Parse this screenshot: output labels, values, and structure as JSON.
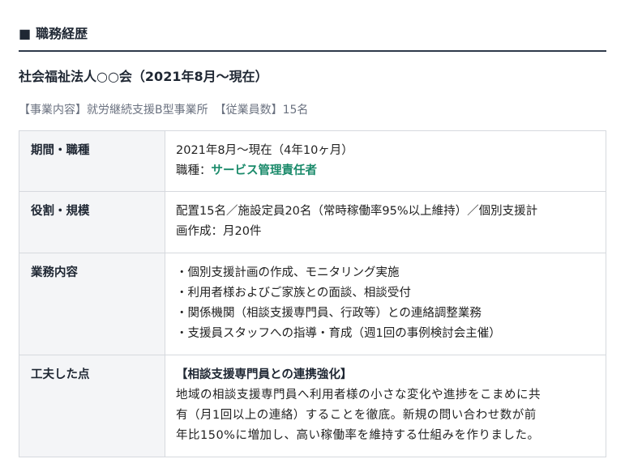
{
  "section": {
    "marker": "■",
    "title": "職務経歴"
  },
  "company": {
    "name": "社会福祉法人○○会（2021年8月〜現在）",
    "business": "【事業内容】就労継続支援B型事業所",
    "employees": "【従業員数】15名"
  },
  "rows": [
    {
      "label": "期間・職種",
      "lines": [
        "2021年8月〜現在（4年10ヶ月）"
      ],
      "job_prefix": "職種：",
      "job_title": "サービス管理責任者"
    },
    {
      "label": "役割・規模",
      "lines": [
        "配置15名／施設定員20名（常時稼働率95%以上維持）／個別支援計",
        "画作成：月20件"
      ]
    },
    {
      "label": "業務内容",
      "lines": [
        "・個別支援計画の作成、モニタリング実施",
        "・利用者様およびご家族との面談、相談受付",
        "・関係機関（相談支援専門員、行政等）との連絡調整業務",
        "・支援員スタッフへの指導・育成（週1回の事例検討会主催）"
      ]
    },
    {
      "label": "工夫した点",
      "heading": "【相談支援専門員との連携強化】",
      "lines": [
        "地域の相談支援専門員へ利用者様の小さな変化や進捗をこまめに共",
        "有（月1回以上の連絡）することを徹底。新規の問い合わせ数が前",
        "年比150%に増加し、高い稼働率を維持する仕組みを作りました。"
      ]
    }
  ],
  "colors": {
    "accent": "#1a8a6a",
    "heading_rule": "#2f3a4a",
    "label_bg": "#f4f5f7",
    "border": "#d6d9de",
    "meta_text": "#6b7280"
  }
}
